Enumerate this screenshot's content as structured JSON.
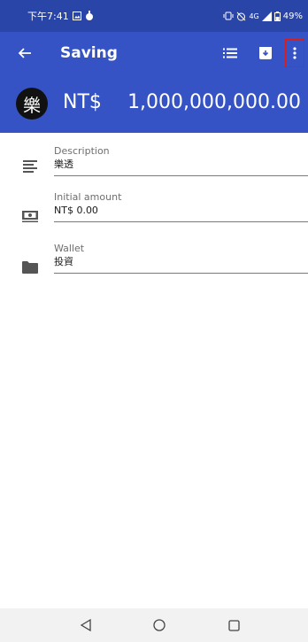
{
  "status_bar": {
    "time": "下午7:41",
    "battery": "49%",
    "network": "4G"
  },
  "app_bar": {
    "title": "Saving",
    "icons": [
      "back-arrow-icon",
      "list-icon",
      "archive-icon",
      "more-vert-icon"
    ]
  },
  "header": {
    "avatar_char": "樂",
    "currency": "NT$",
    "balance": "1,000,000,000.00"
  },
  "form": {
    "description": {
      "label": "Description",
      "value": "樂透",
      "icon": "notes-icon"
    },
    "initial_amount": {
      "label": "Initial amount",
      "value": "NT$ 0.00",
      "icon": "money-icon"
    },
    "wallet": {
      "label": "Wallet",
      "value": "投資",
      "icon": "folder-icon"
    }
  },
  "nav": {
    "icons": [
      "back-triangle-icon",
      "home-circle-icon",
      "recents-square-icon"
    ]
  },
  "colors": {
    "status_bar": "#2a45a8",
    "primary": "#3553c4",
    "highlight": "#d81b1b"
  }
}
